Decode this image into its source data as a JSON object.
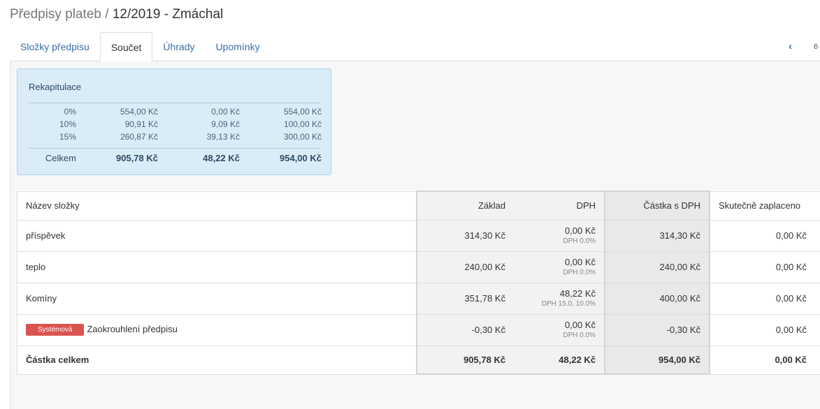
{
  "header": {
    "title_muted": "Předpisy plateb / ",
    "title_main": "12/2019 - Zmáchal"
  },
  "tabs": [
    {
      "label": "Složky předpisu",
      "active": false
    },
    {
      "label": "Součet",
      "active": true
    },
    {
      "label": "Úhrady",
      "active": false
    },
    {
      "label": "Upomínky",
      "active": false
    }
  ],
  "pager": {
    "prev_icon": "chevron-left-icon",
    "page": "6"
  },
  "recap": {
    "title": "Rekapitulace",
    "rows": [
      {
        "rate": "0%",
        "zaklad": "554,00 Kč",
        "dph": "0,00 Kč",
        "castka": "554,00 Kč"
      },
      {
        "rate": "10%",
        "zaklad": "90,91 Kč",
        "dph": "9,09 Kč",
        "castka": "100,00 Kč"
      },
      {
        "rate": "15%",
        "zaklad": "260,87 Kč",
        "dph": "39,13 Kč",
        "castka": "300,00 Kč"
      }
    ],
    "total": {
      "label": "Celkem",
      "zaklad": "905,78 Kč",
      "dph": "48,22 Kč",
      "castka": "954,00 Kč"
    }
  },
  "table": {
    "headers": {
      "name": "Název složky",
      "zaklad": "Základ",
      "dph": "DPH",
      "castka": "Částka s DPH",
      "zaplaceno": "Skutečně zaplaceno"
    },
    "rows": [
      {
        "name": "příspěvek",
        "badge": "",
        "zaklad": "314,30 Kč",
        "dph": "0,00 Kč",
        "dph_sub": "DPH 0.0%",
        "castka": "314,30 Kč",
        "zaplaceno": "0,00 Kč"
      },
      {
        "name": "teplo",
        "badge": "",
        "zaklad": "240,00 Kč",
        "dph": "0,00 Kč",
        "dph_sub": "DPH 0.0%",
        "castka": "240,00 Kč",
        "zaplaceno": "0,00 Kč"
      },
      {
        "name": "Komíny",
        "badge": "",
        "zaklad": "351,78 Kč",
        "dph": "48,22 Kč",
        "dph_sub": "DPH 15.0, 10.0%",
        "castka": "400,00 Kč",
        "zaplaceno": "0,00 Kč"
      },
      {
        "name": "Zaokrouhlení předpisu",
        "badge": "Systémová",
        "zaklad": "-0,30 Kč",
        "dph": "0,00 Kč",
        "dph_sub": "DPH 0.0%",
        "castka": "-0,30 Kč",
        "zaplaceno": "0,00 Kč"
      }
    ],
    "total": {
      "label": "Částka celkem",
      "zaklad": "905,78 Kč",
      "dph": "48,22 Kč",
      "castka": "954,00 Kč",
      "zaplaceno": "0,00 Kč"
    }
  },
  "colors": {
    "accent": "#3b6ea5",
    "badge": "#d9534f",
    "recap_bg": "#d9ecf7"
  }
}
